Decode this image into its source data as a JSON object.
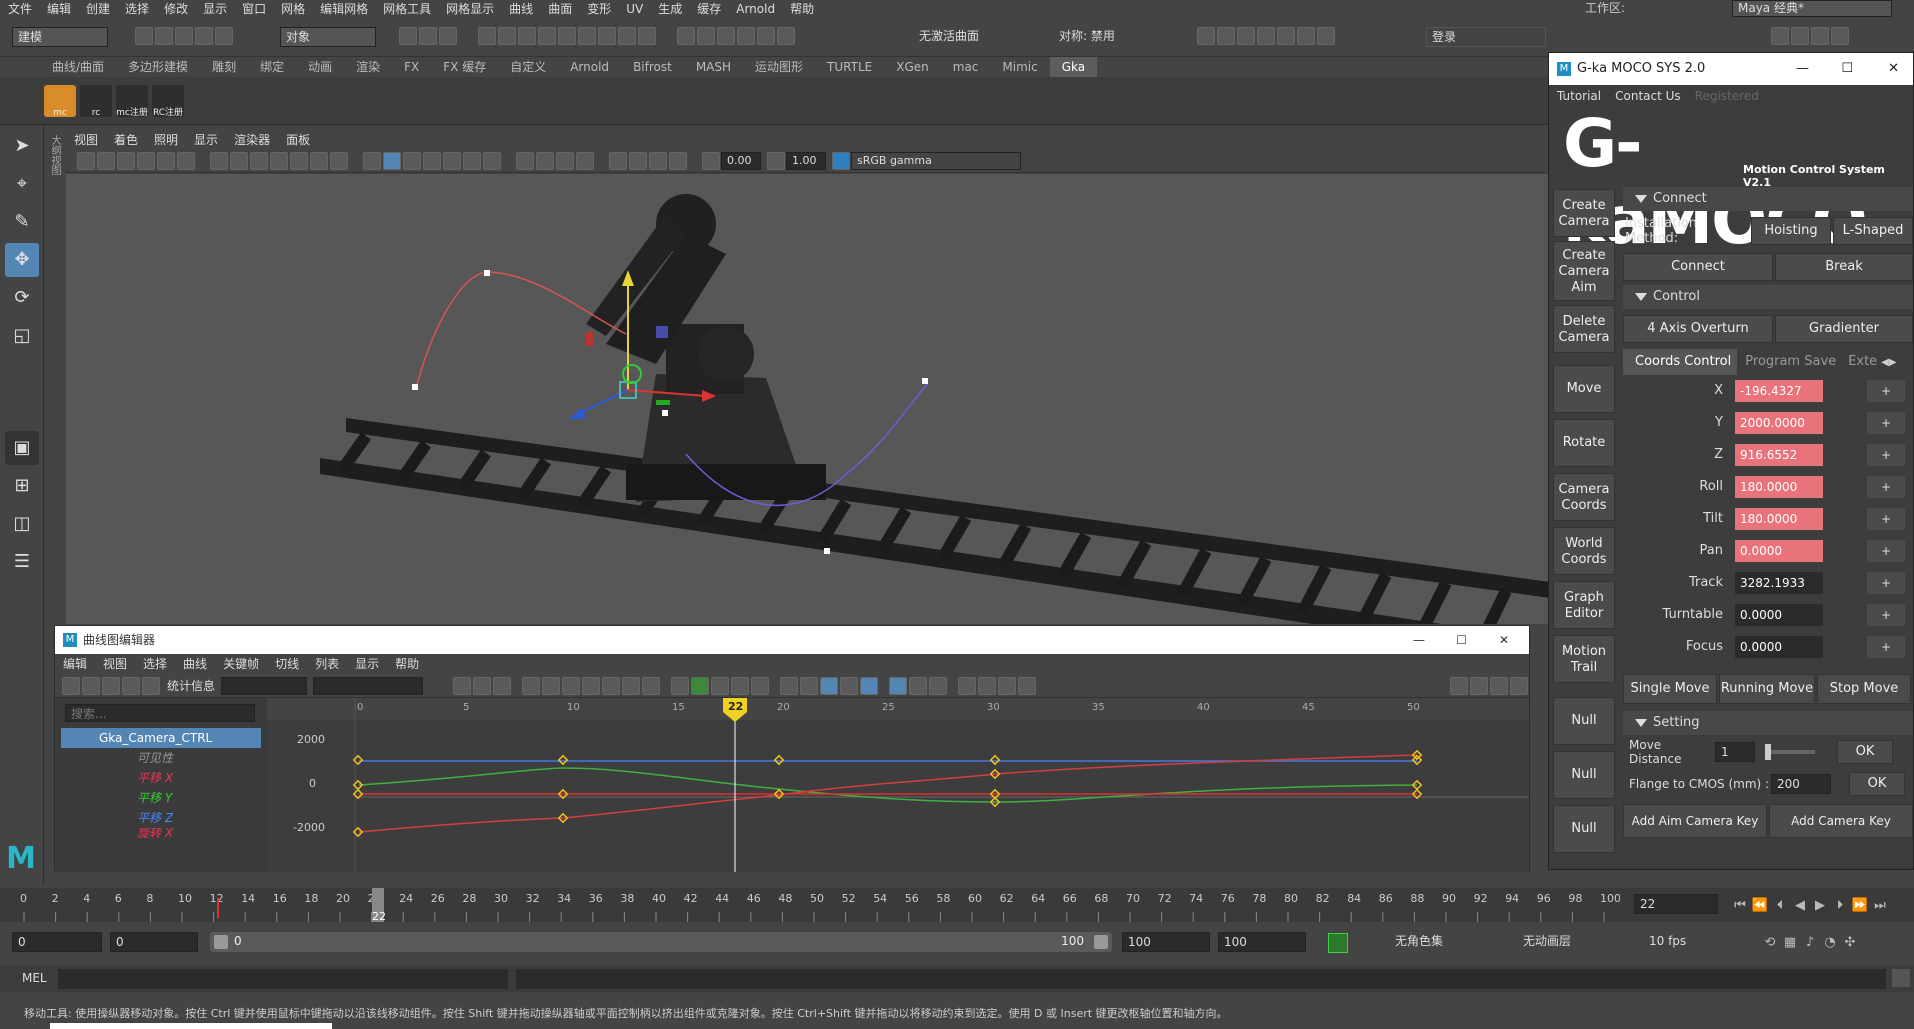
{
  "menubar": {
    "items": [
      "文件",
      "编辑",
      "创建",
      "选择",
      "修改",
      "显示",
      "窗口",
      "网格",
      "编辑网格",
      "网格工具",
      "网格显示",
      "曲线",
      "曲面",
      "变形",
      "UV",
      "生成",
      "缓存",
      "Arnold",
      "帮助"
    ],
    "workspace_label": "工作区:",
    "workspace_value": "Maya 经典*"
  },
  "statusline": {
    "mode": "建模",
    "object_field": "对象",
    "live_surface": "无激活曲面",
    "symmetry": "对称: 禁用",
    "login": "登录"
  },
  "shelf": {
    "tabs": [
      "曲线/曲面",
      "多边形建模",
      "雕刻",
      "绑定",
      "动画",
      "渲染",
      "FX",
      "FX 缓存",
      "自定义",
      "Arnold",
      "Bifrost",
      "MASH",
      "运动图形",
      "TURTLE",
      "XGen",
      "mac",
      "Mimic",
      "Gka"
    ],
    "active_tab": "Gka",
    "buttons": [
      {
        "icon": "mc",
        "label": "mc"
      },
      {
        "icon": "rc",
        "label": "rc"
      },
      {
        "icon": "mc-reg",
        "label": "mc注册"
      },
      {
        "icon": "rc-reg",
        "label": "RC注册"
      }
    ]
  },
  "viewport": {
    "menu": [
      "视图",
      "着色",
      "照明",
      "显示",
      "渲染器",
      "面板"
    ],
    "exposure": "0.00",
    "gamma": "1.00",
    "colorspace": "sRGB gamma",
    "side_label": "大纲视图"
  },
  "graph_editor": {
    "title": "曲线图编辑器",
    "menu": [
      "编辑",
      "视图",
      "选择",
      "曲线",
      "关键帧",
      "切线",
      "列表",
      "显示",
      "帮助"
    ],
    "stats_label": "统计信息",
    "search_placeholder": "搜索...",
    "outliner": {
      "root": "Gka_Camera_CTRL",
      "channels": [
        "可见性",
        "平移 X",
        "平移 Y",
        "平移 Z",
        "旋转 X"
      ]
    },
    "y_ticks": [
      "2000",
      "0",
      "-2000"
    ],
    "x_ticks": [
      "0",
      "5",
      "10",
      "15",
      "20",
      "25",
      "30",
      "35",
      "40",
      "45",
      "50"
    ],
    "current_frame": "22"
  },
  "timeslider": {
    "ticks": [
      "0",
      "2",
      "4",
      "6",
      "8",
      "10",
      "12",
      "14",
      "16",
      "18",
      "20",
      "22",
      "24",
      "26",
      "28",
      "30",
      "32",
      "34",
      "36",
      "38",
      "40",
      "42",
      "44",
      "46",
      "48",
      "50",
      "52",
      "54",
      "56",
      "58",
      "60",
      "62",
      "64",
      "66",
      "68",
      "70",
      "72",
      "74",
      "76",
      "78",
      "80",
      "82",
      "84",
      "86",
      "88",
      "90",
      "92",
      "94",
      "96",
      "98",
      "100"
    ],
    "current_frame": "22",
    "current_field": "22"
  },
  "range": {
    "start": "0",
    "playback_start": "0",
    "range_start_label": "0",
    "range_end_label": "100",
    "playback_end": "100",
    "end": "100",
    "character_set": "无角色集",
    "anim_layer": "无动画层",
    "fps": "10 fps"
  },
  "cmdline": {
    "label": "MEL"
  },
  "helpline": {
    "text": "移动工具: 使用操纵器移动对象。按住 Ctrl 键并使用鼠标中键拖动以沿该线移动组件。按住 Shift 键并拖动操纵器轴或平面控制柄以挤出组件或克隆对象。按住 Ctrl+Shift 键并拖动以将移动约束到选定。使用 D 或 Insert 键更改枢轴位置和轴方向。"
  },
  "moco": {
    "title": "G-ka MOCO SYS 2.0",
    "menu": [
      "Tutorial",
      "Contact Us",
      "Registered"
    ],
    "logo_main": "G-kaMOCO",
    "logo_sub": "Motion Control System V2.1",
    "side_buttons": [
      "Create Camera",
      "Create Camera Aim",
      "Delete Camera",
      "Move",
      "Rotate",
      "Camera Coords",
      "World Coords",
      "Graph Editor",
      "Motion Trail",
      "Null",
      "Null",
      "Null"
    ],
    "connect": {
      "header": "Connect",
      "install_label": "Installation Method:",
      "hoisting": "Hoisting",
      "lshaped": "L-Shaped",
      "connect": "Connect",
      "break": "Break"
    },
    "control": {
      "header": "Control",
      "axis_overturn": "4 Axis Overturn",
      "gradienter": "Gradienter",
      "tabs": [
        "Coords Control",
        "Program Save",
        "Exte"
      ]
    },
    "coords": [
      {
        "label": "X",
        "value": "-196.4327",
        "highlight": true
      },
      {
        "label": "Y",
        "value": "2000.0000",
        "highlight": true
      },
      {
        "label": "Z",
        "value": "916.6552",
        "highlight": true
      },
      {
        "label": "Roll",
        "value": "180.0000",
        "highlight": true
      },
      {
        "label": "Tilt",
        "value": "180.0000",
        "highlight": true
      },
      {
        "label": "Pan",
        "value": "0.0000",
        "highlight": true
      },
      {
        "label": "Track",
        "value": "3282.1933",
        "highlight": false
      },
      {
        "label": "Turntable",
        "value": "0.0000",
        "highlight": false
      },
      {
        "label": "Focus",
        "value": "0.0000",
        "highlight": false
      }
    ],
    "plus": "+",
    "minus": "-",
    "moves": [
      "Single Move",
      "Running Move",
      "Stop Move"
    ],
    "setting": {
      "header": "Setting",
      "move_distance_label": "Move Distance",
      "move_distance_value": "1",
      "ok1": "OK",
      "flange_label": "Flange to CMOS (mm) :",
      "flange_value": "200",
      "ok2": "OK",
      "add_aim_key": "Add Aim Camera Key",
      "add_key": "Add Camera Key"
    },
    "colors": {
      "highlight": "#e8737a"
    }
  }
}
